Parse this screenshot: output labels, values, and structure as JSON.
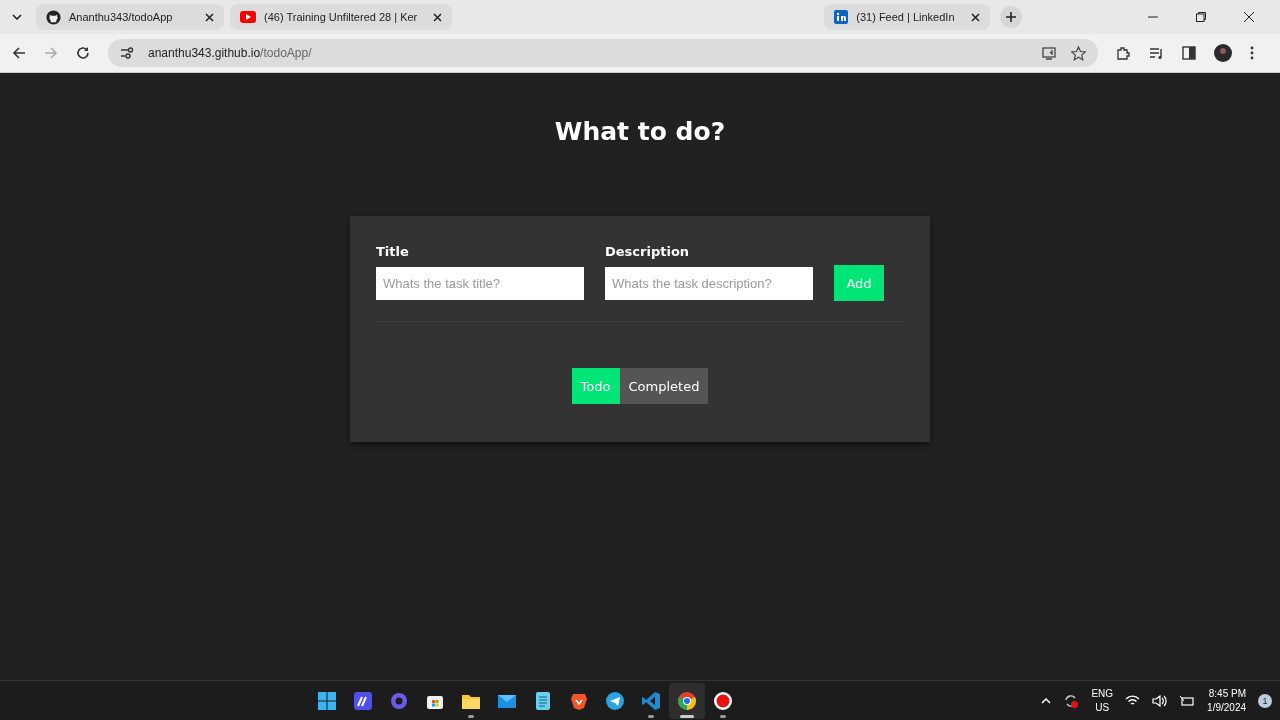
{
  "browser": {
    "tabs": [
      {
        "title": "Ananthu343/todoApp",
        "kind": "github",
        "selected": false
      },
      {
        "title": "(46) Training Unfiltered 28 | Ker",
        "kind": "youtube",
        "selected": false
      },
      {
        "title": "(31) Feed | LinkedIn",
        "kind": "linkedin",
        "selected": false
      }
    ],
    "address": {
      "host": "ananthu343.github.io",
      "path": "/todoApp/"
    }
  },
  "page": {
    "heading": "What to do?",
    "fields": [
      {
        "label": "Title",
        "placeholder": "Whats the task title?"
      },
      {
        "label": "Description",
        "placeholder": "Whats the task description?"
      }
    ],
    "add_button": "Add",
    "filters": [
      {
        "label": "Todo",
        "selected": true
      },
      {
        "label": "Completed",
        "selected": false
      }
    ]
  },
  "taskbar": {
    "apps": [
      {
        "kind": "start",
        "running": false,
        "active": false
      },
      {
        "kind": "editor",
        "running": false,
        "active": false
      },
      {
        "kind": "copilot",
        "running": false,
        "active": false
      },
      {
        "kind": "store",
        "running": false,
        "active": false
      },
      {
        "kind": "folder",
        "running": true,
        "active": false
      },
      {
        "kind": "mail",
        "running": false,
        "active": false
      },
      {
        "kind": "notepad",
        "running": false,
        "active": false
      },
      {
        "kind": "brave",
        "running": false,
        "active": false
      },
      {
        "kind": "telegram",
        "running": false,
        "active": false
      },
      {
        "kind": "vscode",
        "running": true,
        "active": false
      },
      {
        "kind": "chrome",
        "running": true,
        "active": true
      },
      {
        "kind": "record",
        "running": true,
        "active": false
      }
    ],
    "language": [
      "ENG",
      "US"
    ],
    "time": "8:45 PM",
    "date": "1/9/2024",
    "notifications": "1"
  }
}
